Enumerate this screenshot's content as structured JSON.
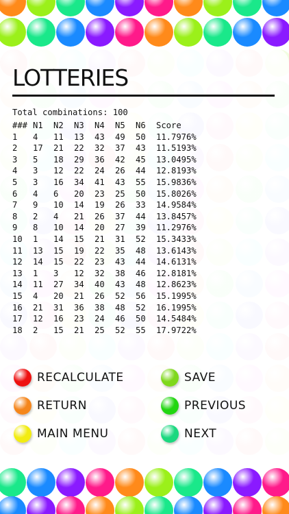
{
  "title": "LOTTERIES",
  "summary": "Total combinations: 100",
  "table": {
    "headers": [
      "###",
      "N1",
      "N2",
      "N3",
      "N4",
      "N5",
      "N6",
      "Score"
    ],
    "rows": [
      [
        "1",
        "4",
        "11",
        "13",
        "43",
        "49",
        "50",
        "11.7976%"
      ],
      [
        "2",
        "17",
        "21",
        "22",
        "32",
        "37",
        "43",
        "11.5193%"
      ],
      [
        "3",
        "5",
        "18",
        "29",
        "36",
        "42",
        "45",
        "13.0495%"
      ],
      [
        "4",
        "3",
        "12",
        "22",
        "24",
        "26",
        "44",
        "12.8193%"
      ],
      [
        "5",
        "3",
        "16",
        "34",
        "41",
        "43",
        "55",
        "15.9836%"
      ],
      [
        "6",
        "4",
        "6",
        "20",
        "23",
        "25",
        "50",
        "15.8026%"
      ],
      [
        "7",
        "9",
        "10",
        "14",
        "19",
        "26",
        "33",
        "14.9584%"
      ],
      [
        "8",
        "2",
        "4",
        "21",
        "26",
        "37",
        "44",
        "13.8457%"
      ],
      [
        "9",
        "8",
        "10",
        "14",
        "20",
        "27",
        "39",
        "11.2976%"
      ],
      [
        "10",
        "1",
        "14",
        "15",
        "21",
        "31",
        "52",
        "15.3433%"
      ],
      [
        "11",
        "13",
        "15",
        "19",
        "22",
        "35",
        "48",
        "13.6143%"
      ],
      [
        "12",
        "14",
        "15",
        "22",
        "23",
        "43",
        "44",
        "14.6131%"
      ],
      [
        "13",
        "1",
        "3",
        "12",
        "32",
        "38",
        "46",
        "12.8181%"
      ],
      [
        "14",
        "11",
        "27",
        "34",
        "40",
        "43",
        "48",
        "12.8623%"
      ],
      [
        "15",
        "4",
        "20",
        "21",
        "26",
        "52",
        "56",
        "15.1995%"
      ],
      [
        "16",
        "21",
        "31",
        "36",
        "38",
        "48",
        "52",
        "16.1995%"
      ],
      [
        "17",
        "12",
        "16",
        "23",
        "24",
        "46",
        "50",
        "14.5484%"
      ],
      [
        "18",
        "2",
        "15",
        "21",
        "25",
        "52",
        "55",
        "17.9722%"
      ]
    ]
  },
  "buttons": {
    "recalculate": {
      "label": "RECALCULATE",
      "color": "#ee1111"
    },
    "save": {
      "label": "SAVE",
      "color": "#7fd81c"
    },
    "return": {
      "label": "RETURN",
      "color": "#f5861c"
    },
    "previous": {
      "label": "PREVIOUS",
      "color": "#22d611"
    },
    "main_menu": {
      "label": "MAIN MENU",
      "color": "#f2ec12"
    },
    "next": {
      "label": "NEXT",
      "color": "#1bd87f"
    }
  },
  "background_colors": [
    "#ff1a1a",
    "#ff8a1a",
    "#ffee1a",
    "#9bf01a",
    "#22e822",
    "#1ae88a",
    "#1ae8e8",
    "#1a8aff",
    "#1a1aff",
    "#8a1aff",
    "#ff1aff",
    "#ff1a8a"
  ]
}
